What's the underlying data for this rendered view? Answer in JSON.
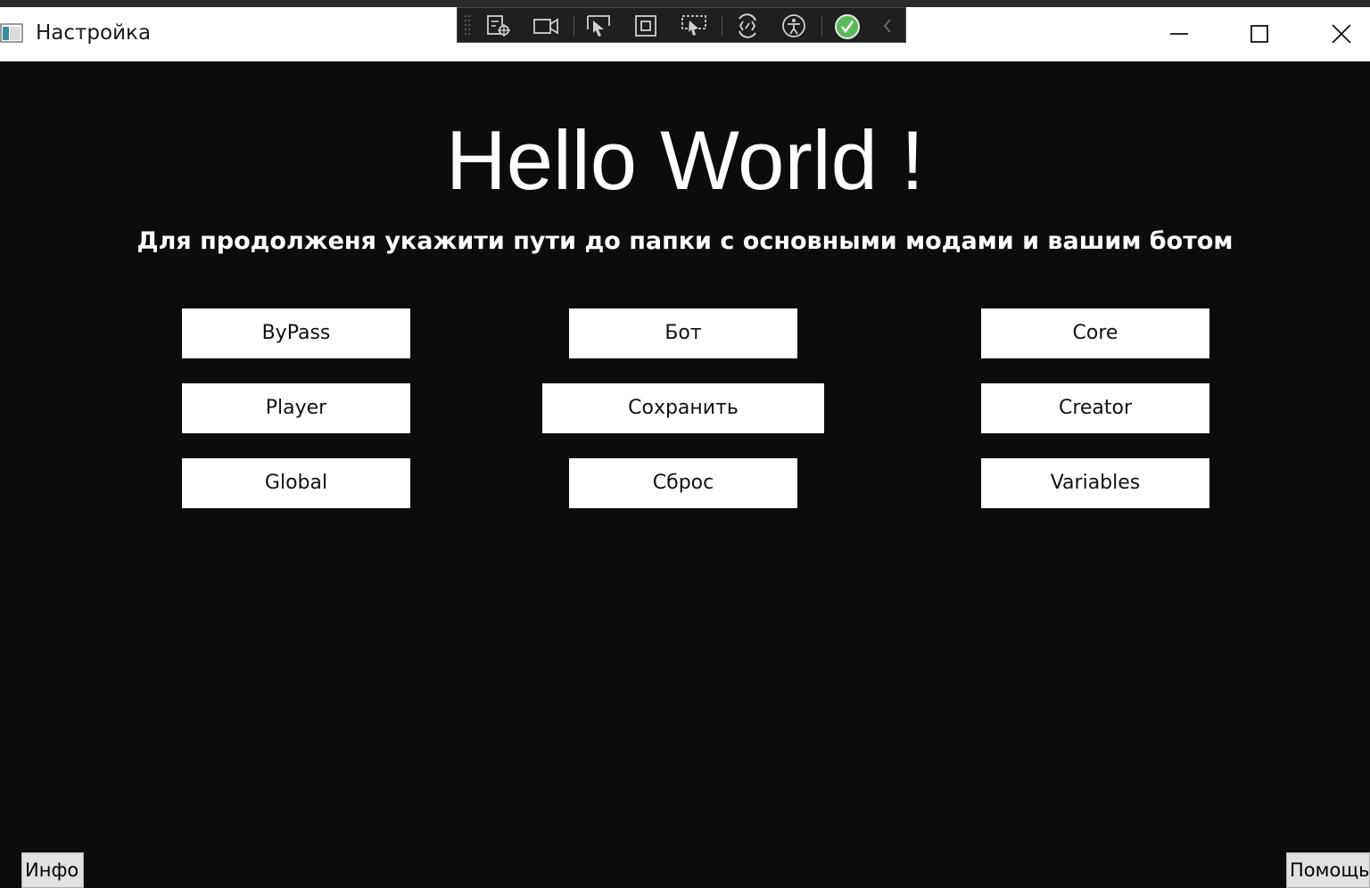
{
  "window": {
    "title": "Настройка",
    "icon": "app-window-icon",
    "controls": [
      "minimize-icon",
      "maximize-icon",
      "close-icon"
    ]
  },
  "debug_toolbar": {
    "icons": [
      "grip-icon",
      "live-visual-tree-icon",
      "video-camera-icon",
      "select-element-icon",
      "display-layout-adorners-icon",
      "track-focus-icon",
      "hot-reload-icon",
      "accessibility-icon",
      "success-check-icon",
      "collapse-chevron-icon"
    ]
  },
  "main": {
    "heading": "Hello World !",
    "subheading": "Для продолженя укажити пути до папки с основными модами и вашим ботом",
    "buttons": {
      "bypass": "ByPass",
      "bot": "Бот",
      "core": "Core",
      "player": "Player",
      "save": "Сохранить",
      "creator": "Creator",
      "global": "Global",
      "reset": "Сброс",
      "variables": "Variables"
    }
  },
  "footer": {
    "info": "Инфо",
    "help": "Помощь"
  },
  "colors": {
    "background": "#0c0c0c",
    "titlebar": "#ffffff",
    "button": "#ffffff",
    "toolbar": "#1f1f1f",
    "success": "#5cb85c"
  }
}
